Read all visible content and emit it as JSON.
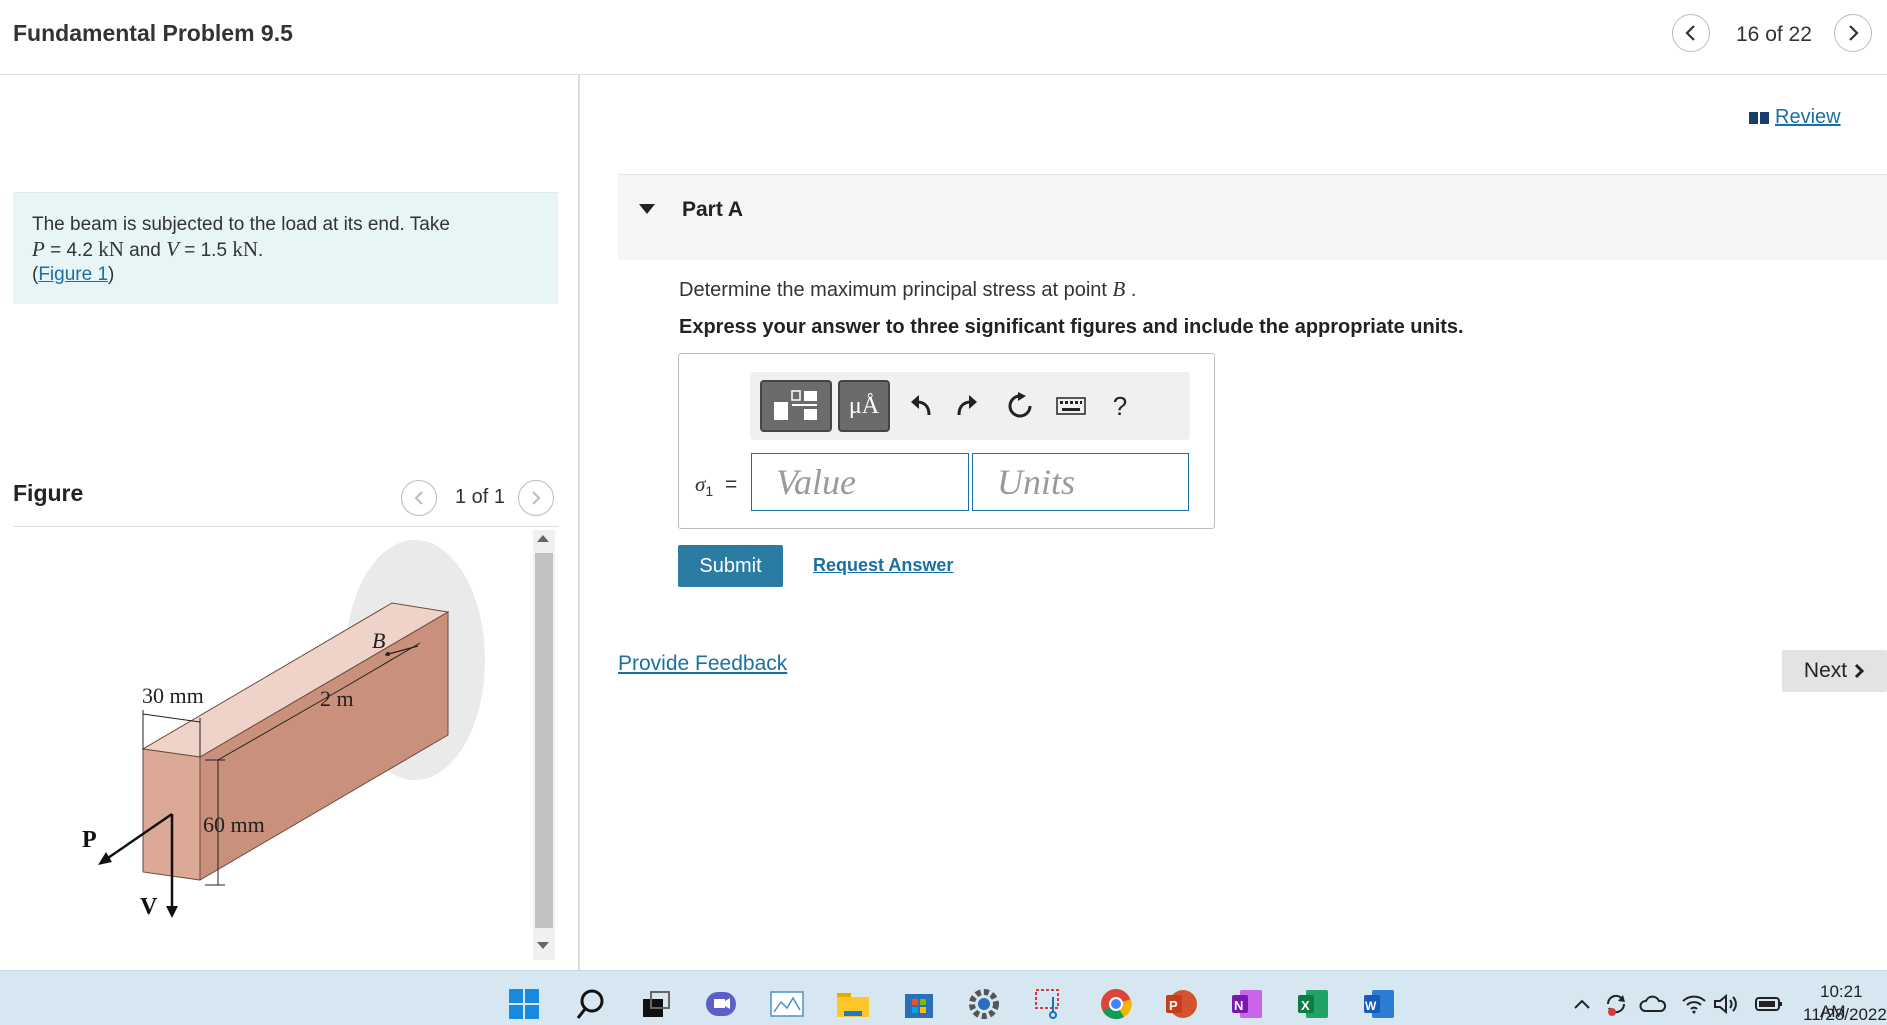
{
  "header": {
    "title": "Fundamental Problem 9.5",
    "counter": "16 of 22"
  },
  "problem": {
    "line1": "The beam is subjected to the load at its end. Take",
    "p_symbol": "P",
    "p_value": "= 4.2",
    "p_unit": "kN",
    "and": "and",
    "v_symbol": "V",
    "v_value": "= 1.5",
    "v_unit": "kN",
    "period": ".",
    "figure_link": "Figure 1",
    "paren_open": "(",
    "paren_close": ")"
  },
  "figure": {
    "label": "Figure",
    "counter": "1 of 1",
    "labels": {
      "b": "B",
      "length": "2 m",
      "width": "30 mm",
      "height": "60 mm",
      "p": "P",
      "v": "V"
    }
  },
  "review": {
    "label": "Review"
  },
  "part_a": {
    "label": "Part A",
    "question_prefix": "Determine the maximum principal stress at point",
    "question_point": "B",
    "question_suffix": ".",
    "instruction": "Express your answer to three significant figures and include the appropriate units.",
    "sigma_label": "σ",
    "sigma_sub": "1",
    "equals": "=",
    "value_placeholder": "Value",
    "units_placeholder": "Units",
    "tool_mu": "μÅ",
    "tool_help": "?",
    "submit": "Submit",
    "request_answer": "Request Answer"
  },
  "feedback": {
    "label": "Provide Feedback"
  },
  "next": {
    "label": "Next"
  },
  "taskbar": {
    "time": "10:21 AM",
    "date": "11/28/2022",
    "icons": [
      "windows-start-icon",
      "search-icon",
      "task-view-icon",
      "teams-chat-icon",
      "photos-icon",
      "file-explorer-icon",
      "microsoft-store-icon",
      "settings-icon",
      "snipping-tool-icon",
      "chrome-icon",
      "powerpoint-icon",
      "onenote-icon",
      "excel-icon",
      "word-icon"
    ]
  },
  "colors": {
    "link": "#1a6fa5",
    "submit": "#2b7ca3",
    "problem_bg": "#e8f5f6",
    "taskbar_bg": "#d6e7f1",
    "beam_front": "#d9a895",
    "beam_side": "#c98f7a",
    "beam_top": "#efd3c8"
  }
}
